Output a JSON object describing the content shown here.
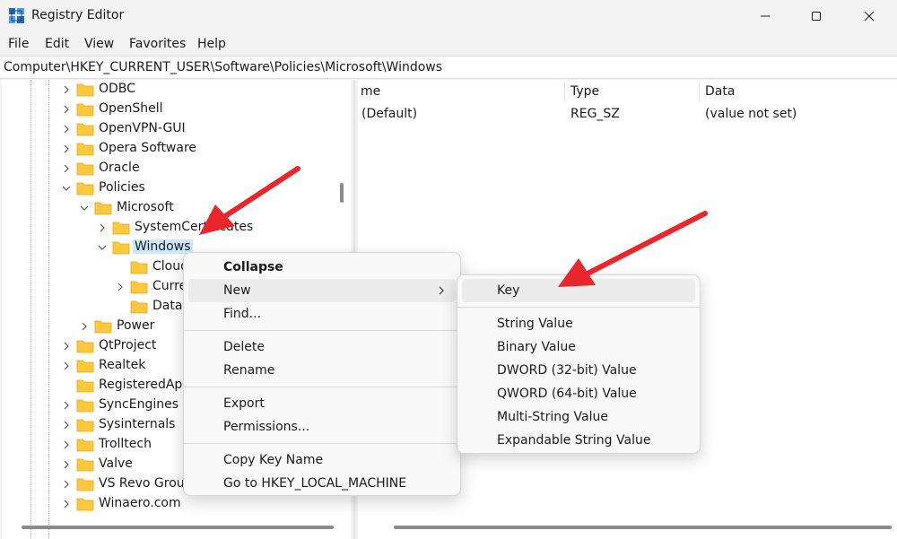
{
  "window": {
    "title": "Registry Editor",
    "app_icon": "registry-icon",
    "controls": [
      "minimize-icon",
      "maximize-icon",
      "close-icon"
    ]
  },
  "menubar": [
    "File",
    "Edit",
    "View",
    "Favorites",
    "Help"
  ],
  "address": "Computer\\HKEY_CURRENT_USER\\Software\\Policies\\Microsoft\\Windows",
  "tree": {
    "odbc": "ODBC",
    "openshell": "OpenShell",
    "openvpn": "OpenVPN-GUI",
    "opera": "Opera Software",
    "oracle": "Oracle",
    "policies": "Policies",
    "microsoft": "Microsoft",
    "systemcertificates": "SystemCertificates",
    "windows": "Windows",
    "cloud": "Cloud",
    "current": "Curre",
    "data": "Data",
    "power": "Power",
    "qtproject": "QtProject",
    "realtek": "Realtek",
    "registeredapp": "RegisteredApp",
    "syncengines": "SyncEngines",
    "sysinternals": "Sysinternals",
    "trolltech": "Trolltech",
    "valve": "Valve",
    "vsrevo": "VS Revo Group",
    "winaero": "Winaero.com"
  },
  "values_pane": {
    "columns": [
      "me",
      "Type",
      "Data"
    ],
    "rows": [
      {
        "name": "(Default)",
        "type": "REG_SZ",
        "data": "(value not set)"
      }
    ]
  },
  "context_menu": {
    "collapse": "Collapse",
    "new": "New",
    "find": "Find...",
    "delete": "Delete",
    "rename": "Rename",
    "export": "Export",
    "permissions": "Permissions...",
    "copy_key_name": "Copy Key Name",
    "goto": "Go to HKEY_LOCAL_MACHINE"
  },
  "submenu": {
    "key": "Key",
    "string_value": "String Value",
    "binary_value": "Binary Value",
    "dword_value": "DWORD (32-bit) Value",
    "qword_value": "QWORD (64-bit) Value",
    "multi_string_value": "Multi-String Value",
    "expandable_string_value": "Expandable String Value"
  },
  "colors": {
    "folder": "#ffc83d",
    "selection": "#cce8ff",
    "annotation_arrow": "#e8262b",
    "menu_hover": "#ececec"
  }
}
